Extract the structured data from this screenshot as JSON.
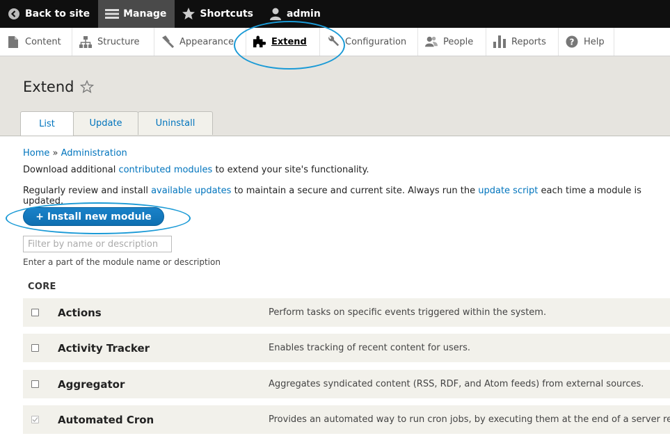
{
  "toolbar": {
    "back_label": "Back to site",
    "manage_label": "Manage",
    "shortcuts_label": "Shortcuts",
    "user_label": "admin"
  },
  "tray": {
    "items": [
      {
        "label": "Content",
        "icon": "page-icon"
      },
      {
        "label": "Structure",
        "icon": "hierarchy-icon"
      },
      {
        "label": "Appearance",
        "icon": "paintbrush-icon"
      },
      {
        "label": "Extend",
        "icon": "puzzle-icon"
      },
      {
        "label": "Configuration",
        "icon": "wrench-icon"
      },
      {
        "label": "People",
        "icon": "people-icon"
      },
      {
        "label": "Reports",
        "icon": "bar-chart-icon"
      },
      {
        "label": "Help",
        "icon": "help-icon"
      }
    ]
  },
  "page": {
    "title": "Extend",
    "tabs": [
      {
        "label": "List"
      },
      {
        "label": "Update"
      },
      {
        "label": "Uninstall"
      }
    ],
    "breadcrumb": {
      "home": "Home",
      "sep": "»",
      "admin": "Administration"
    },
    "intro1": {
      "pre": "Download additional ",
      "link": "contributed modules",
      "post": " to extend your site's functionality."
    },
    "intro2": {
      "pre": "Regularly review and install ",
      "link1": "available updates",
      "mid": " to maintain a secure and current site. Always run the ",
      "link2": "update script",
      "post": " each time a module is updated."
    },
    "install_button": "+ Install new module",
    "filter_placeholder": "Filter by name or description",
    "filter_hint": "Enter a part of the module name or description",
    "section": "CORE",
    "modules": [
      {
        "name": "Actions",
        "desc": "Perform tasks on specific events triggered within the system.",
        "checked": false
      },
      {
        "name": "Activity Tracker",
        "desc": "Enables tracking of recent content for users.",
        "checked": false
      },
      {
        "name": "Aggregator",
        "desc": "Aggregates syndicated content (RSS, RDF, and Atom feeds) from external sources.",
        "checked": false
      },
      {
        "name": "Automated Cron",
        "desc": "Provides an automated way to run cron jobs, by executing them at the end of a server respo",
        "checked": true
      }
    ]
  },
  "colors": {
    "link": "#0074bd",
    "button": "#0e6fb1",
    "annotation": "#1a9ad6"
  }
}
